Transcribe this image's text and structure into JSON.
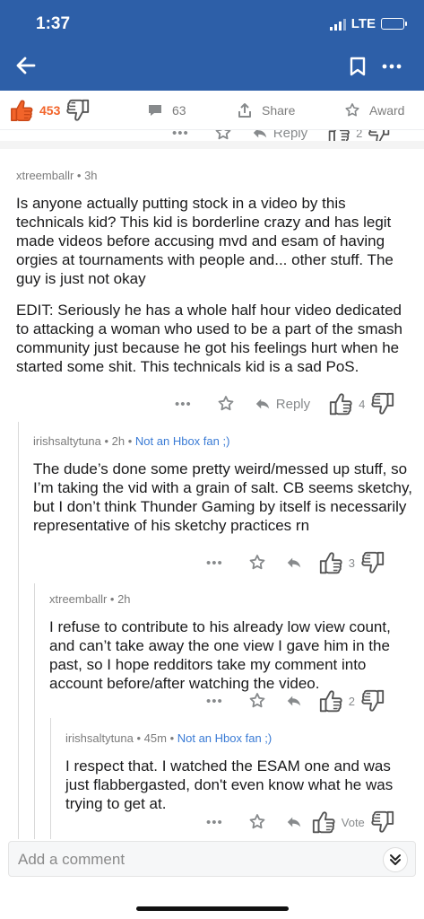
{
  "status": {
    "time": "1:37",
    "network": "LTE"
  },
  "post": {
    "score": "453",
    "comments": "63",
    "share_label": "Share",
    "award_label": "Award"
  },
  "peek": {
    "reply_label": "Reply",
    "count": "2"
  },
  "comments": [
    {
      "author": "xtreemballr",
      "time": "3h",
      "flair": "",
      "paragraphs": [
        "Is anyone actually putting stock in a video by this technicals kid? This kid is borderline crazy and has legit made videos before accusing mvd and esam of having orgies at tournaments with people and... other stuff. The guy is just not okay",
        "EDIT: Seriously he has a whole half hour video dedicated to attacking a woman who used to be a part of the smash community just because he got his feelings hurt when he started some shit. This technicals kid is a sad PoS."
      ],
      "reply_label": "Reply",
      "votes": "4"
    },
    {
      "author": "irishsaltytuna",
      "time": "2h",
      "flair": "Not an Hbox fan ;)",
      "paragraphs": [
        "The dude’s done some pretty weird/messed up stuff, so I’m taking the vid with a grain of salt. CB seems sketchy, but I don’t think Thunder Gaming by itself is necessarily representative of his sketchy practices rn"
      ],
      "votes": "3"
    },
    {
      "author": "xtreemballr",
      "time": "2h",
      "flair": "",
      "paragraphs": [
        "I refuse to contribute to his already low view count, and can’t take away the one view I gave him in the past, so I hope redditors take my comment into account before/after watching the video."
      ],
      "votes": "2"
    },
    {
      "author": "irishsaltytuna",
      "time": "45m",
      "flair": "Not an Hbox fan ;)",
      "paragraphs": [
        "I respect that. I watched the ESAM one and was just flabbergasted, don't even know what he was trying to get at."
      ],
      "votes": "Vote"
    }
  ],
  "composer": {
    "placeholder": "Add a comment"
  },
  "icons": {
    "back": "arrow-left-icon",
    "save": "bookmark-icon",
    "more": "more-icon",
    "upvote": "thumbs-up-icon",
    "downvote": "thumbs-down-icon",
    "comments": "comment-icon",
    "share": "share-icon",
    "award": "award-icon",
    "reply": "reply-icon",
    "expand": "chevron-double-down-icon"
  },
  "colors": {
    "header": "#2d5fa8",
    "upvoted": "#f2642a",
    "flair": "#3a7bd5"
  }
}
